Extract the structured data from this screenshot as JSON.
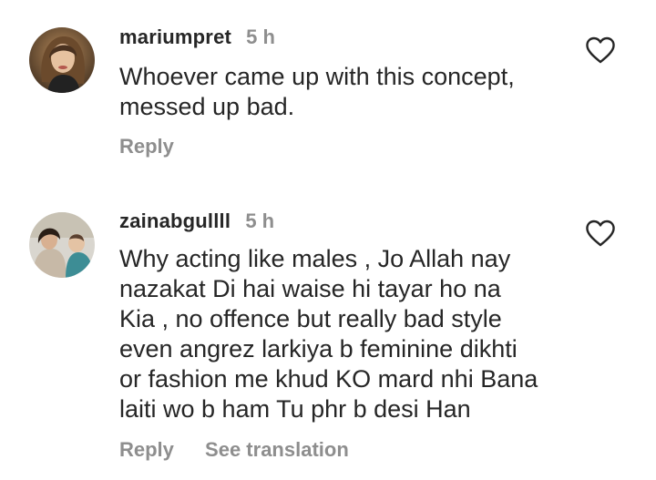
{
  "comments": [
    {
      "username": "mariumpret",
      "time": "5 h",
      "text_lines": [
        "Whoever came up with this concept,",
        "messed up bad."
      ],
      "reply_label": "Reply",
      "avatar_icon": "profile-photo-woman",
      "like_icon": "heart-outline-icon"
    },
    {
      "username": "zainabgullll",
      "time": "5 h",
      "text_lines": [
        "Why acting like males , Jo Allah nay",
        "nazakat Di hai waise hi tayar ho na",
        "Kia , no offence but really bad style",
        "even angrez larkiya b feminine dikhti",
        "or fashion me khud KO mard nhi Bana",
        "laiti wo b ham Tu phr b desi Han"
      ],
      "reply_label": "Reply",
      "translation_label": "See translation",
      "avatar_icon": "profile-photo-woman-with-child",
      "like_icon": "heart-outline-icon"
    }
  ],
  "colors": {
    "primary_text": "#262626",
    "secondary_text": "#8e8e8e",
    "background": "#ffffff"
  }
}
